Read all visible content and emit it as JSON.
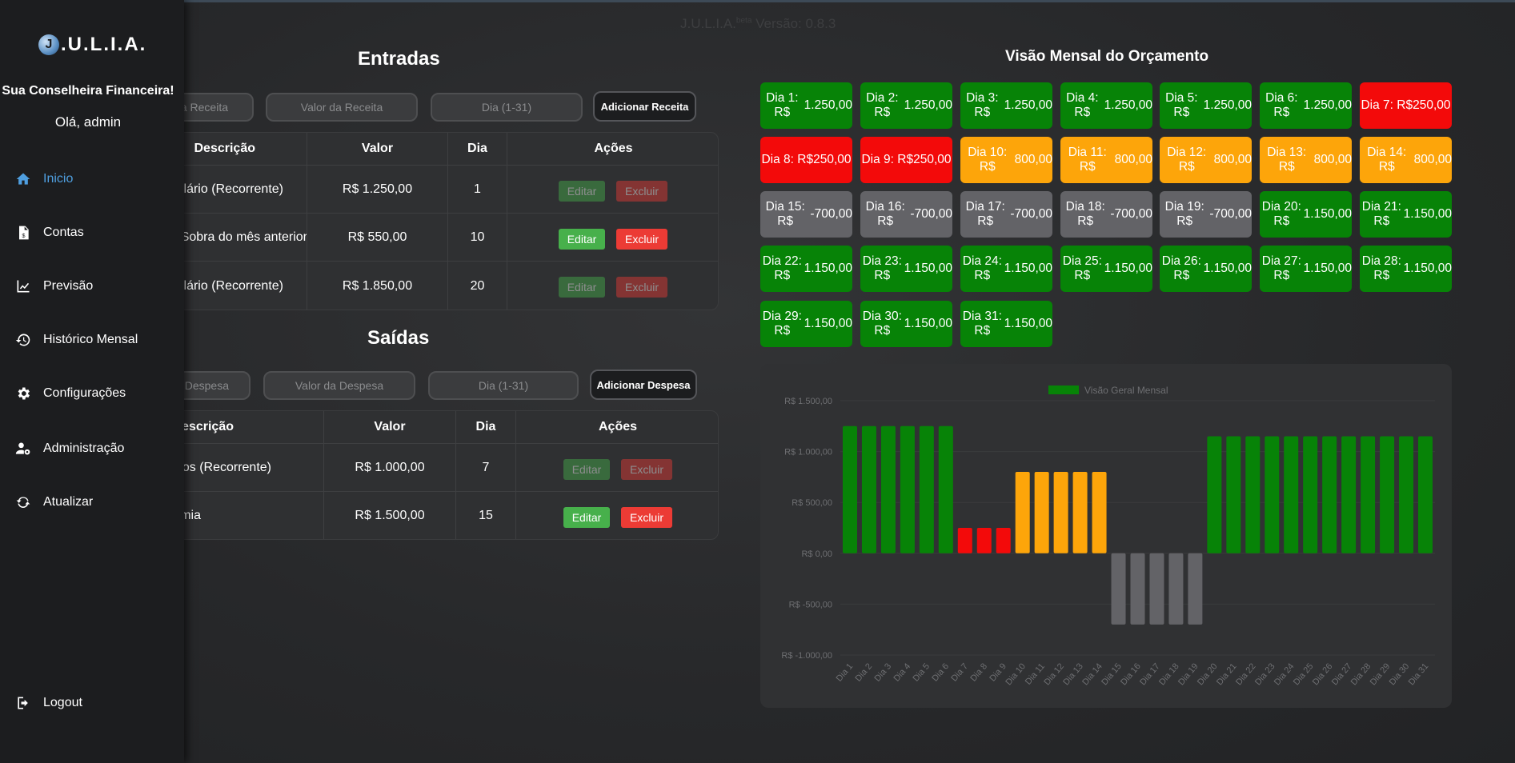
{
  "app": {
    "logo_letter": "J",
    "logo_text": ".U.L.I.A.",
    "version_name": "J.U.L.I.A.",
    "version_sup": "beta",
    "version_text": "Versão: 0.8.3"
  },
  "sidebar": {
    "tagline": "Sua Conselheira Financeira!",
    "greeting": "Olá, admin",
    "items": [
      {
        "label": "Inicio",
        "icon": "home-icon",
        "active": true
      },
      {
        "label": "Contas",
        "icon": "invoice-icon"
      },
      {
        "label": "Previsão",
        "icon": "chart-line-icon"
      },
      {
        "label": "Histórico Mensal",
        "icon": "history-icon"
      },
      {
        "label": "Configurações",
        "icon": "gear-icon"
      },
      {
        "label": "Administração",
        "icon": "user-gear-icon"
      },
      {
        "label": "Atualizar",
        "icon": "refresh-icon"
      }
    ],
    "logout": "Logout"
  },
  "entradas": {
    "title": "Entradas",
    "desc_placeholder": "Descrição da Receita",
    "value_placeholder": "Valor da Receita",
    "day_placeholder": "Dia (1-31)",
    "add_button": "Adicionar Receita",
    "headers": [
      "Descrição",
      "Valor",
      "Dia",
      "Ações"
    ],
    "rows": [
      {
        "desc": "Salário (Recorrente)",
        "value": "R$ 1.250,00",
        "day": "1",
        "recurrent": true
      },
      {
        "desc": "Sobra do mês anterior",
        "value": "R$ 550,00",
        "day": "10",
        "recurrent": false
      },
      {
        "desc": "Salário (Recorrente)",
        "value": "R$ 1.850,00",
        "day": "20",
        "recurrent": true
      }
    ]
  },
  "saidas": {
    "title": "Saídas",
    "desc_placeholder": "Descrição da Despesa",
    "value_placeholder": "Valor da Despesa",
    "day_placeholder": "Dia (1-31)",
    "add_button": "Adicionar Despesa",
    "headers": [
      "Descrição",
      "Valor",
      "Dia",
      "Ações"
    ],
    "rows": [
      {
        "desc": "Gastos Fixos (Recorrente)",
        "value": "R$ 1.000,00",
        "day": "7",
        "recurrent": true
      },
      {
        "desc": "Economia",
        "value": "R$ 1.500,00",
        "day": "15",
        "recurrent": false
      }
    ]
  },
  "actions": {
    "edit": "Editar",
    "delete": "Excluir"
  },
  "monthly": {
    "title": "Visão Mensal do Orçamento",
    "days": [
      {
        "label": "Dia 1: R$",
        "amount": "1.250,00",
        "status": "green"
      },
      {
        "label": "Dia 2: R$",
        "amount": "1.250,00",
        "status": "green"
      },
      {
        "label": "Dia 3: R$",
        "amount": "1.250,00",
        "status": "green"
      },
      {
        "label": "Dia 4: R$",
        "amount": "1.250,00",
        "status": "green"
      },
      {
        "label": "Dia 5: R$",
        "amount": "1.250,00",
        "status": "green"
      },
      {
        "label": "Dia 6: R$",
        "amount": "1.250,00",
        "status": "green"
      },
      {
        "label": "Dia 7: R$",
        "amount": "250,00",
        "status": "red"
      },
      {
        "label": "Dia 8: R$",
        "amount": "250,00",
        "status": "red"
      },
      {
        "label": "Dia 9: R$",
        "amount": "250,00",
        "status": "red"
      },
      {
        "label": "Dia 10: R$",
        "amount": "800,00",
        "status": "orange"
      },
      {
        "label": "Dia 11: R$",
        "amount": "800,00",
        "status": "orange"
      },
      {
        "label": "Dia 12: R$",
        "amount": "800,00",
        "status": "orange"
      },
      {
        "label": "Dia 13: R$",
        "amount": "800,00",
        "status": "orange"
      },
      {
        "label": "Dia 14: R$",
        "amount": "800,00",
        "status": "orange"
      },
      {
        "label": "Dia 15: R$",
        "amount": "-700,00",
        "status": "gray"
      },
      {
        "label": "Dia 16: R$",
        "amount": "-700,00",
        "status": "gray"
      },
      {
        "label": "Dia 17: R$",
        "amount": "-700,00",
        "status": "gray"
      },
      {
        "label": "Dia 18: R$",
        "amount": "-700,00",
        "status": "gray"
      },
      {
        "label": "Dia 19: R$",
        "amount": "-700,00",
        "status": "gray"
      },
      {
        "label": "Dia 20: R$",
        "amount": "1.150,00",
        "status": "green"
      },
      {
        "label": "Dia 21: R$",
        "amount": "1.150,00",
        "status": "green"
      },
      {
        "label": "Dia 22: R$",
        "amount": "1.150,00",
        "status": "green"
      },
      {
        "label": "Dia 23: R$",
        "amount": "1.150,00",
        "status": "green"
      },
      {
        "label": "Dia 24: R$",
        "amount": "1.150,00",
        "status": "green"
      },
      {
        "label": "Dia 25: R$",
        "amount": "1.150,00",
        "status": "green"
      },
      {
        "label": "Dia 26: R$",
        "amount": "1.150,00",
        "status": "green"
      },
      {
        "label": "Dia 27: R$",
        "amount": "1.150,00",
        "status": "green"
      },
      {
        "label": "Dia 28: R$",
        "amount": "1.150,00",
        "status": "green"
      },
      {
        "label": "Dia 29: R$",
        "amount": "1.150,00",
        "status": "green"
      },
      {
        "label": "Dia 30: R$",
        "amount": "1.150,00",
        "status": "green"
      },
      {
        "label": "Dia 31: R$",
        "amount": "1.150,00",
        "status": "green"
      }
    ]
  },
  "colors": {
    "green": "#078307",
    "red": "#f30a0a",
    "orange": "#fda50a",
    "gray": "#636367",
    "accent": "#4f9fe0"
  },
  "chart_data": {
    "type": "bar",
    "legend": "Visão Geral Mensal",
    "legend_position": "top",
    "categories": [
      "Dia 1",
      "Dia 2",
      "Dia 3",
      "Dia 4",
      "Dia 5",
      "Dia 6",
      "Dia 7",
      "Dia 8",
      "Dia 9",
      "Dia 10",
      "Dia 11",
      "Dia 12",
      "Dia 13",
      "Dia 14",
      "Dia 15",
      "Dia 16",
      "Dia 17",
      "Dia 18",
      "Dia 19",
      "Dia 20",
      "Dia 21",
      "Dia 22",
      "Dia 23",
      "Dia 24",
      "Dia 25",
      "Dia 26",
      "Dia 27",
      "Dia 28",
      "Dia 29",
      "Dia 30",
      "Dia 31"
    ],
    "values": [
      1250,
      1250,
      1250,
      1250,
      1250,
      1250,
      250,
      250,
      250,
      800,
      800,
      800,
      800,
      800,
      -700,
      -700,
      -700,
      -700,
      -700,
      1150,
      1150,
      1150,
      1150,
      1150,
      1150,
      1150,
      1150,
      1150,
      1150,
      1150,
      1150
    ],
    "yticks": [
      "R$ 1.500,00",
      "R$ 1.000,00",
      "R$ 500,00",
      "R$ 0,00",
      "R$ -500,00",
      "R$ -1.000,00"
    ],
    "ytick_values": [
      1500,
      1000,
      500,
      0,
      -500,
      -1000
    ],
    "ylim": [
      -1000,
      1500
    ],
    "grid": true
  }
}
